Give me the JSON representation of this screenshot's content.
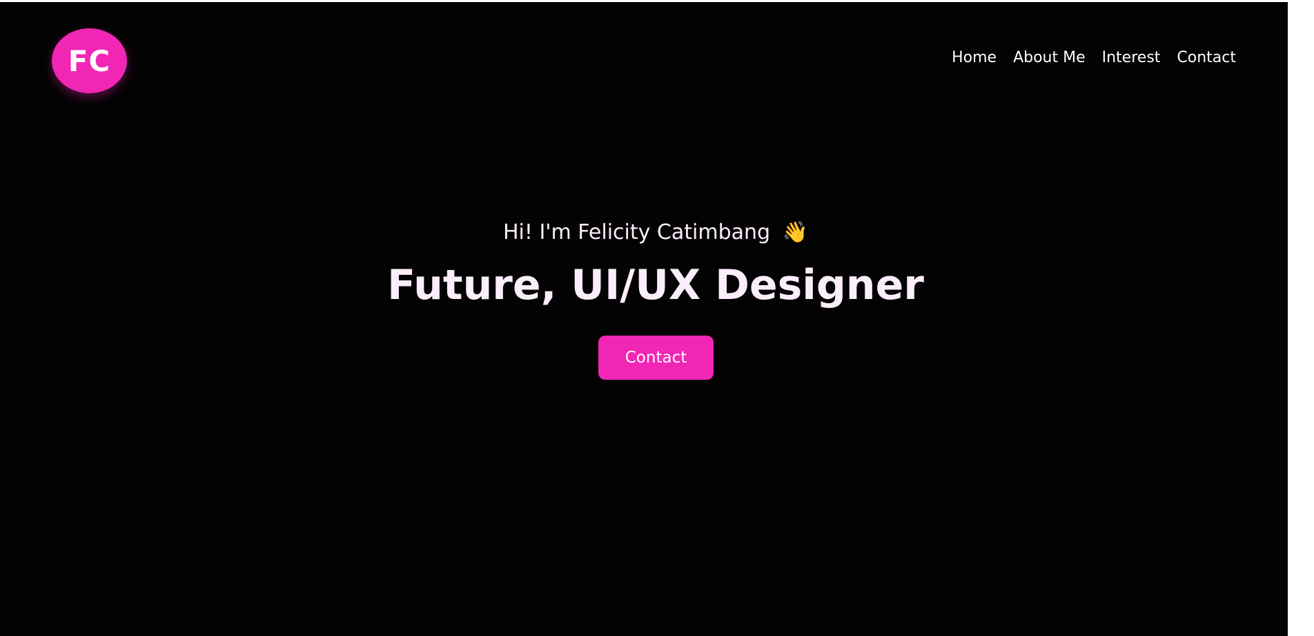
{
  "header": {
    "logo_text": "FC",
    "nav": [
      {
        "label": "Home"
      },
      {
        "label": "About Me"
      },
      {
        "label": "Interest"
      },
      {
        "label": "Contact"
      }
    ]
  },
  "hero": {
    "greeting": "Hi! I'm Felicity Catimbang",
    "wave_icon": "👋",
    "title": "Future, UI/UX Designer",
    "cta_label": "Contact"
  },
  "colors": {
    "background": "#040304",
    "accent": "#f126b4",
    "text": "#fbeefb"
  }
}
